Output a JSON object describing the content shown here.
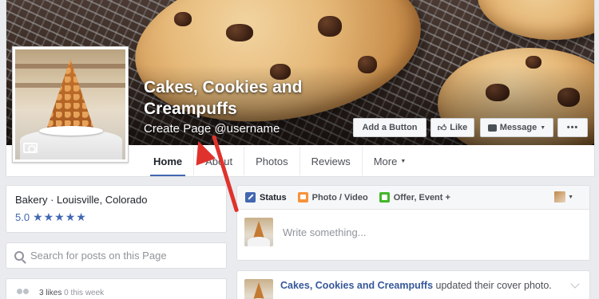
{
  "page": {
    "name": "Cakes, Cookies and Creampuffs",
    "username_link": "Create Page @username"
  },
  "cover_buttons": {
    "add_button": "Add a Button",
    "like": "Like",
    "message": "Message",
    "more": "•••"
  },
  "tabs": [
    {
      "label": "Home"
    },
    {
      "label": "About"
    },
    {
      "label": "Photos"
    },
    {
      "label": "Reviews"
    },
    {
      "label": "More"
    }
  ],
  "about": {
    "category_location": "Bakery · Louisville, Colorado",
    "rating_value": "5.0",
    "stars": "★★★★★"
  },
  "search": {
    "placeholder": "Search for posts on this Page"
  },
  "likes": {
    "count": "3 likes",
    "period": "0 this week"
  },
  "composer": {
    "tabs": [
      {
        "label": "Status",
        "icon": "pencil-icon"
      },
      {
        "label": "Photo / Video",
        "icon": "photo-icon"
      },
      {
        "label": "Offer, Event +",
        "icon": "offer-icon"
      }
    ],
    "placeholder": "Write something..."
  },
  "post": {
    "page_name": "Cakes, Cookies and Creampuffs",
    "action": " updated their cover photo."
  },
  "colors": {
    "accent": "#4267b2",
    "link": "#365899",
    "annotation_arrow": "#e0322d"
  }
}
